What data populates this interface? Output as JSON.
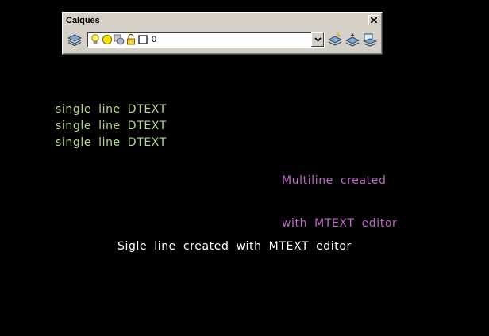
{
  "toolbar": {
    "title": "Calques",
    "close_icon": "close-icon",
    "current_layer": "0",
    "buttons": [
      {
        "name": "layer-properties-manager",
        "icon": "layers-icon"
      },
      {
        "name": "make-object-layer-current",
        "icon": "layer-current-icon"
      },
      {
        "name": "layer-previous",
        "icon": "layer-previous-icon"
      },
      {
        "name": "layer-state",
        "icon": "layer-state-icon"
      }
    ],
    "layer_state_icons": [
      "lightbulb-on-icon",
      "sun-thaw-icon",
      "viewport-freeze-icon",
      "padlock-icon",
      "color-swatch-icon"
    ],
    "color_swatch": "#ffffff"
  },
  "drawing": {
    "dtext_lines": [
      "single line DTEXT",
      "single line DTEXT",
      "single line DTEXT"
    ],
    "mtext_multiline": [
      "Multiline created",
      "with MTEXT editor"
    ],
    "mtext_single": "Sigle line created with MTEXT editor",
    "colors": {
      "dtext": "#b5d98a",
      "mtext_multiline": "#c067c9",
      "mtext_single": "#ffffff",
      "background": "#000000"
    }
  }
}
